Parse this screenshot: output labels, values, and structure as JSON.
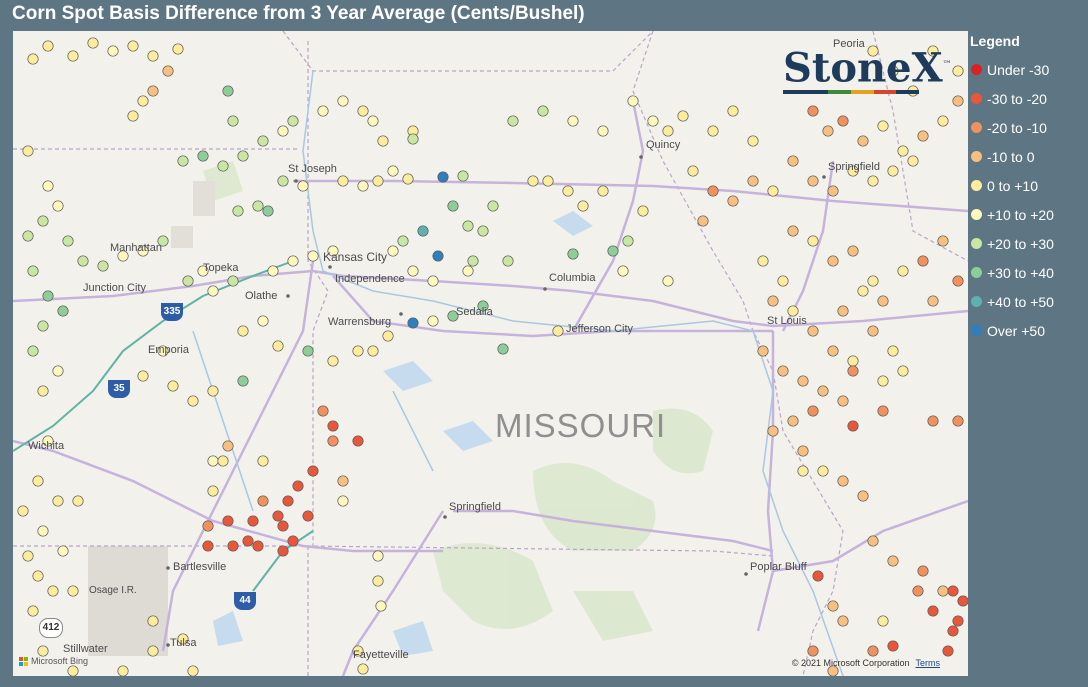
{
  "title": "Corn Spot Basis Difference from 3 Year Average (Cents/Bushel)",
  "legend": {
    "title": "Legend",
    "items": [
      {
        "label": "Under -30",
        "color": "#d92323"
      },
      {
        "label": "-30 to -20",
        "color": "#e8573a"
      },
      {
        "label": "-20 to -10",
        "color": "#f0915e"
      },
      {
        "label": "-10 to 0",
        "color": "#f7c080"
      },
      {
        "label": "0 to +10",
        "color": "#fcec9c"
      },
      {
        "label": "+10 to +20",
        "color": "#fdf8bc"
      },
      {
        "label": "+20 to +30",
        "color": "#c9e7a3"
      },
      {
        "label": "+30 to +40",
        "color": "#8fcd98"
      },
      {
        "label": "+40 to +50",
        "color": "#5fb0b0"
      },
      {
        "label": "Over +50",
        "color": "#2f7fbf"
      }
    ]
  },
  "map": {
    "state_label": "MISSOURI",
    "places": [
      "St Joseph",
      "Manhattan",
      "Topeka",
      "Kansas City",
      "Independence",
      "Junction City",
      "Olathe",
      "Columbia",
      "Warrensburg",
      "Sedalia",
      "Jefferson City",
      "Emporia",
      "Wichita",
      "Springfield",
      "Bartlesville",
      "Osage I.R.",
      "Tulsa",
      "Stillwater",
      "Fayetteville",
      "Poplar Bluff",
      "St Louis",
      "Peoria",
      "Quincy",
      "Springfield"
    ],
    "shields": [
      "335",
      "35",
      "44",
      "412"
    ],
    "attribution": "Microsoft Bing",
    "copyright": "© 2021 Microsoft Corporation",
    "terms": "Terms"
  },
  "logo": {
    "text": "StoneX",
    "tm": "™"
  }
}
